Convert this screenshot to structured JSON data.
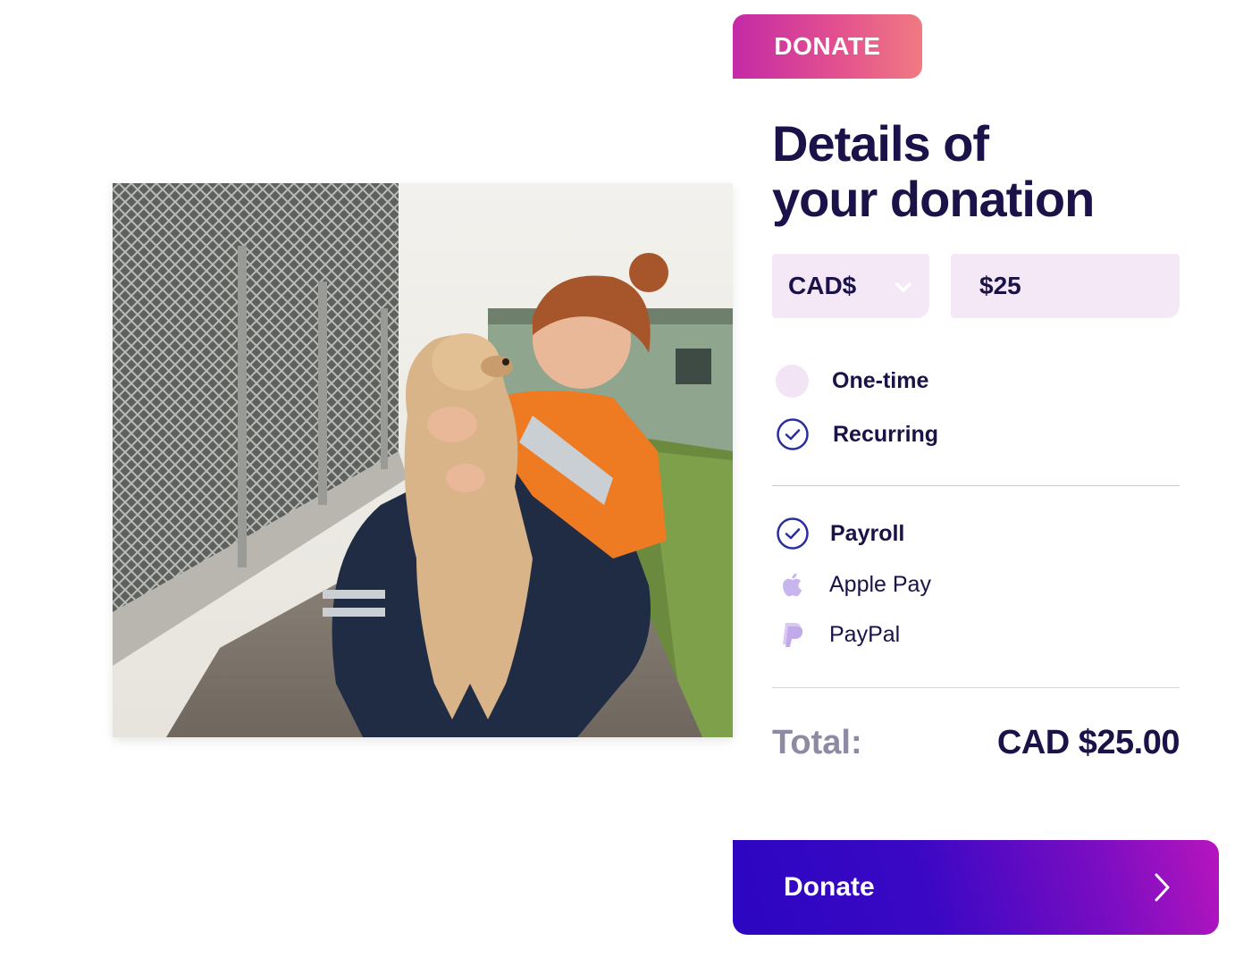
{
  "tab": {
    "label": "DONATE"
  },
  "heading": {
    "line1": "Details of",
    "line2": "your donation"
  },
  "currency": {
    "selected": "CAD$",
    "icon": "chevron-down-icon"
  },
  "amount": {
    "value": "$25"
  },
  "frequency": [
    {
      "label": "One-time",
      "selected": false
    },
    {
      "label": "Recurring",
      "selected": true
    }
  ],
  "payment_methods": [
    {
      "label": "Payroll",
      "selected": true,
      "icon": "check-circle-icon"
    },
    {
      "label": "Apple Pay",
      "selected": false,
      "icon": "apple-icon"
    },
    {
      "label": "PayPal",
      "selected": false,
      "icon": "paypal-icon"
    }
  ],
  "total": {
    "label": "Total:",
    "value": "CAD $25.00"
  },
  "submit": {
    "label": "Donate",
    "icon": "chevron-right-icon"
  },
  "colors": {
    "primary_text": "#1a1248",
    "muted_text": "#8e8aa3",
    "field_bg": "#f5e8f6",
    "accent_blue": "#2c06c2",
    "accent_pink": "#e3508f"
  }
}
